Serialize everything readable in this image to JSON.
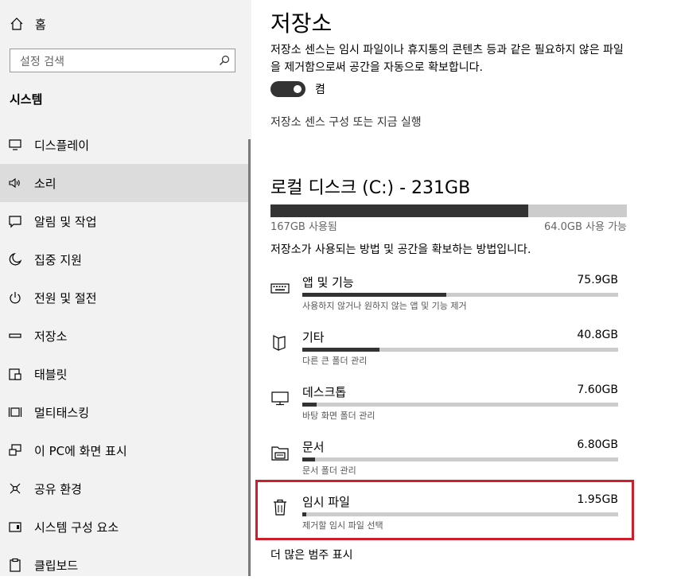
{
  "sidebar": {
    "home_label": "홈",
    "search_placeholder": "설정 검색",
    "section_title": "시스템",
    "items": [
      {
        "label": "디스플레이",
        "icon": "monitor-icon"
      },
      {
        "label": "소리",
        "icon": "speaker-icon"
      },
      {
        "label": "알림 및 작업",
        "icon": "message-icon"
      },
      {
        "label": "집중 지원",
        "icon": "moon-icon"
      },
      {
        "label": "전원 및 절전",
        "icon": "power-icon"
      },
      {
        "label": "저장소",
        "icon": "drive-icon"
      },
      {
        "label": "태블릿",
        "icon": "tablet-icon"
      },
      {
        "label": "멀티태스킹",
        "icon": "multitask-icon"
      },
      {
        "label": "이 PC에 화면 표시",
        "icon": "project-icon"
      },
      {
        "label": "공유 환경",
        "icon": "share-icon"
      },
      {
        "label": "시스템 구성 요소",
        "icon": "components-icon"
      },
      {
        "label": "클립보드",
        "icon": "clipboard-icon"
      }
    ],
    "active_item": "소리"
  },
  "main": {
    "title": "저장소",
    "description": "저장소 센스는 임시 파일이나 휴지통의 콘텐츠 등과 같은 필요하지 않은 파일을 제거함으로써 공간을 자동으로 확보합니다.",
    "toggle_state": "켬",
    "toggle_on": true,
    "configure_link": "저장소 센스 구성 또는 지금 실행",
    "drive": {
      "title": "로컬 디스크 (C:) - 231GB",
      "used_label": "167GB 사용됨",
      "free_label": "64.0GB 사용 가능",
      "used_fraction": 0.723
    },
    "intro": "저장소가 사용되는 방법 및 공간을 확보하는 방법입니다.",
    "categories": [
      {
        "name": "앱 및 기능",
        "size": "75.9GB",
        "sub": "사용하지 않거나 원하지 않는 앱 및 기능 제거",
        "fraction": 0.455,
        "icon": "keyboard-icon"
      },
      {
        "name": "기타",
        "size": "40.8GB",
        "sub": "다른 큰 폴더 관리",
        "fraction": 0.245,
        "icon": "other-files-icon"
      },
      {
        "name": "데스크톱",
        "size": "7.60GB",
        "sub": "바탕 화면 폴더 관리",
        "fraction": 0.046,
        "icon": "desktop-icon"
      },
      {
        "name": "문서",
        "size": "6.80GB",
        "sub": "문서 폴더 관리",
        "fraction": 0.041,
        "icon": "documents-folder-icon"
      },
      {
        "name": "임시 파일",
        "size": "1.95GB",
        "sub": "제거할 임시 파일 선택",
        "fraction": 0.012,
        "icon": "trash-icon"
      }
    ],
    "more_link": "더 많은 범주 표시"
  },
  "colors": {
    "sidebar_bg": "#f2f2f2",
    "active_bg": "#dcdcdc",
    "bar_fill": "#333333",
    "bar_track": "#cccccc",
    "highlight": "#cc1f2b"
  }
}
